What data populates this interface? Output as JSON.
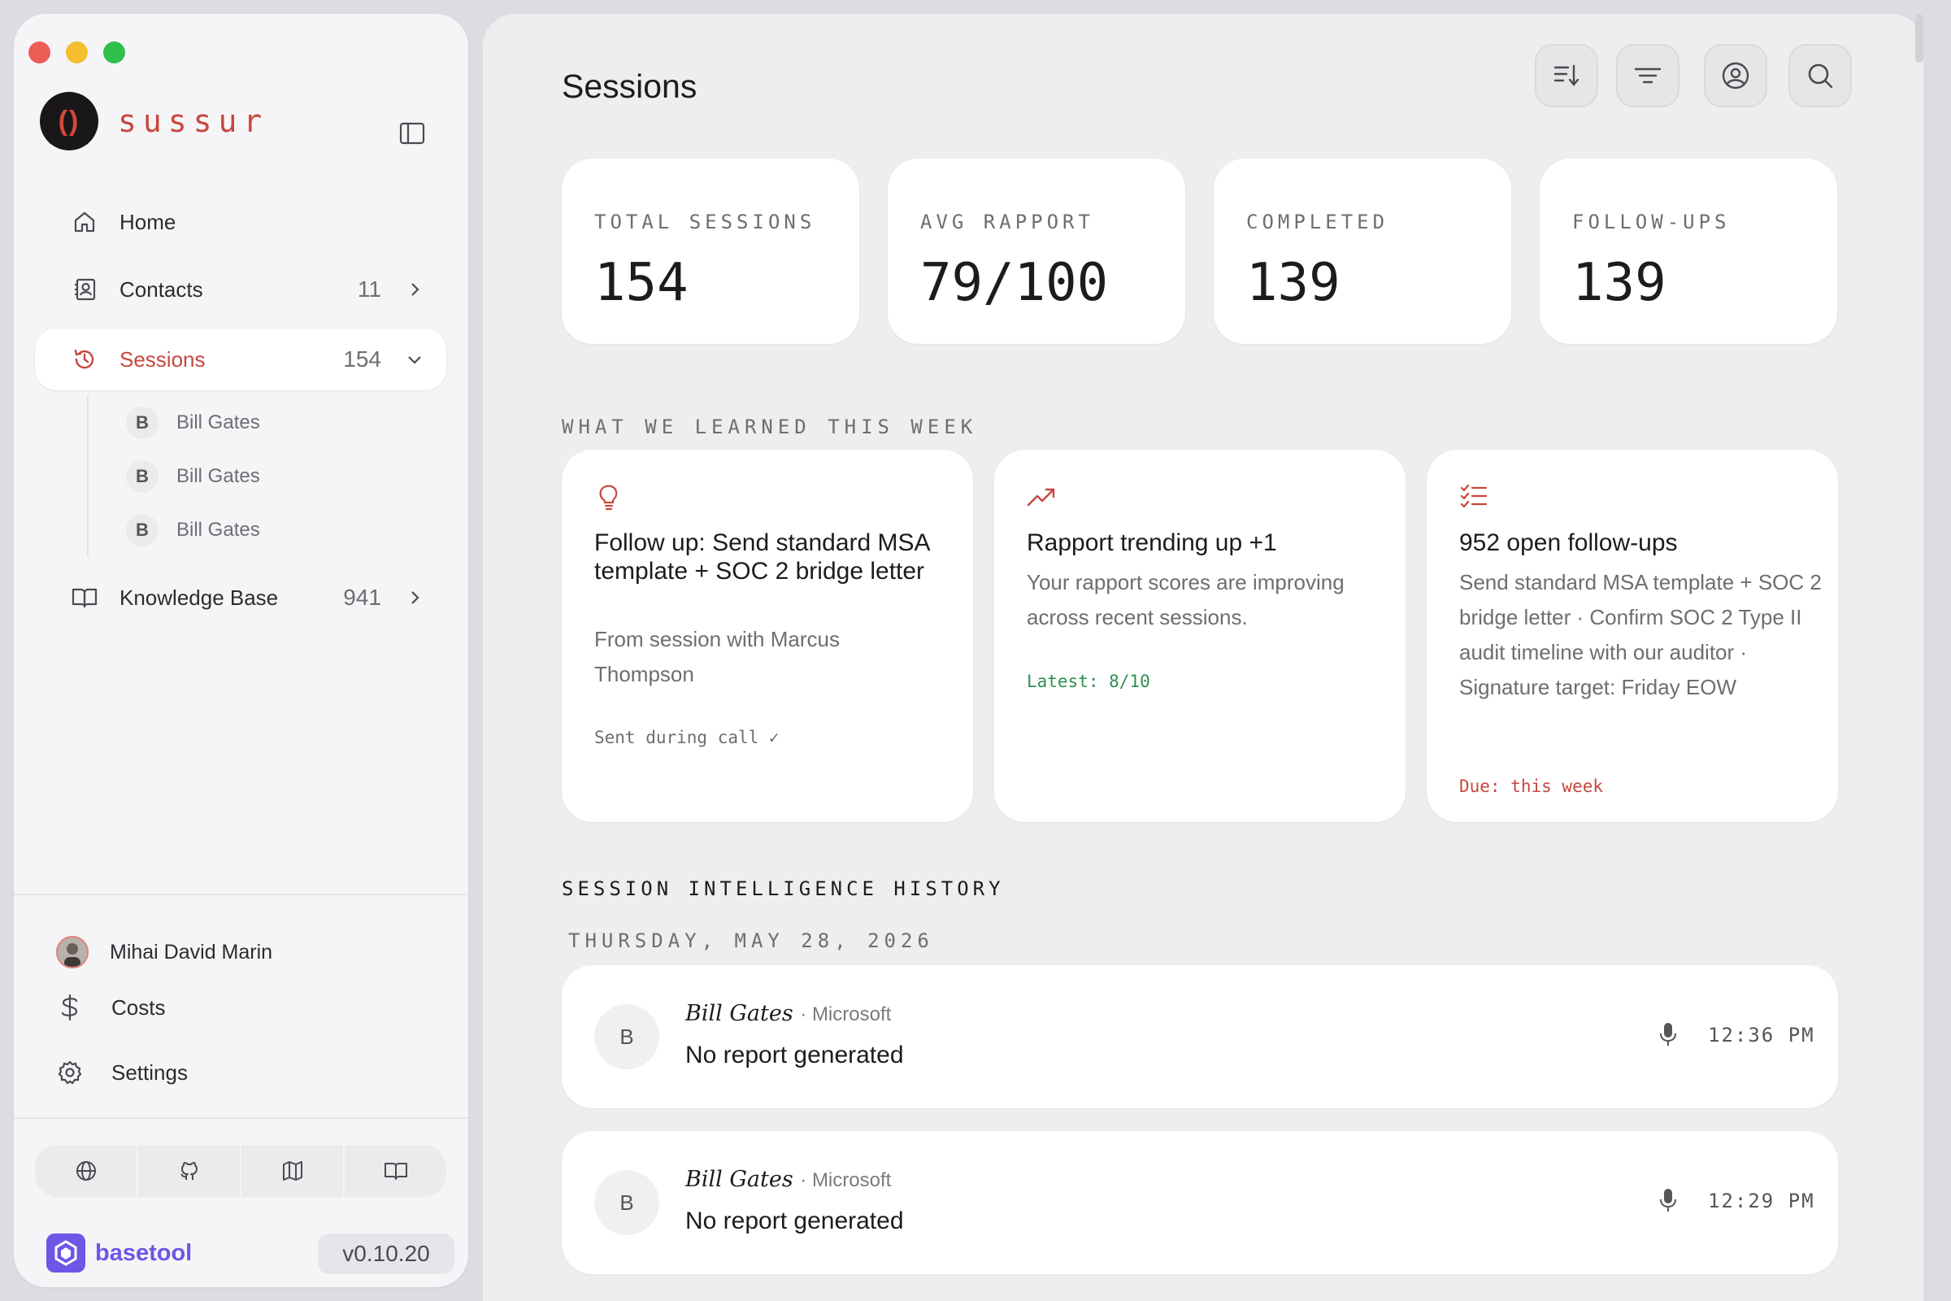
{
  "brand": {
    "name": "sussur",
    "logo_glyph": "()"
  },
  "nav": {
    "home": {
      "label": "Home"
    },
    "contacts": {
      "label": "Contacts",
      "count": "11"
    },
    "sessions": {
      "label": "Sessions",
      "count": "154"
    },
    "knowledge": {
      "label": "Knowledge Base",
      "count": "941"
    },
    "session_children": [
      {
        "initial": "B",
        "label": "Bill Gates"
      },
      {
        "initial": "B",
        "label": "Bill Gates"
      },
      {
        "initial": "B",
        "label": "Bill Gates"
      }
    ]
  },
  "user": {
    "name": "Mihai David Marin"
  },
  "bottom_nav": {
    "costs": "Costs",
    "settings": "Settings"
  },
  "footer": {
    "brand": "basetool",
    "version": "v0.10.20"
  },
  "page": {
    "title": "Sessions"
  },
  "stats": [
    {
      "label": "TOTAL SESSIONS",
      "value": "154"
    },
    {
      "label": "AVG RAPPORT",
      "value": "79/100"
    },
    {
      "label": "COMPLETED",
      "value": "139"
    },
    {
      "label": "FOLLOW-UPS",
      "value": "139"
    }
  ],
  "learned": {
    "heading": "WHAT WE LEARNED THIS WEEK",
    "cards": [
      {
        "icon": "lightbulb-icon",
        "title": "Follow up: Send standard MSA template + SOC 2 bridge letter",
        "text": "From session with Marcus Thompson",
        "meta": "Sent during call ✓"
      },
      {
        "icon": "trending-up-icon",
        "title": "Rapport trending up +1",
        "text": "Your rapport scores are improving across recent sessions.",
        "meta": "Latest: 8/10"
      },
      {
        "icon": "checklist-icon",
        "title": "952 open follow-ups",
        "text": "Send standard MSA template + SOC 2 bridge letter · Confirm SOC 2 Type II audit timeline with our auditor · Signature target: Friday EOW",
        "meta": "Due: this week"
      }
    ]
  },
  "history": {
    "heading": "SESSION INTELLIGENCE HISTORY",
    "date": "THURSDAY, MAY 28, 2026",
    "sessions": [
      {
        "initial": "B",
        "name": "Bill Gates",
        "company": "· Microsoft",
        "report": "No report generated",
        "time": "12:36 PM"
      },
      {
        "initial": "B",
        "name": "Bill Gates",
        "company": "· Microsoft",
        "report": "No report generated",
        "time": "12:29 PM"
      }
    ]
  },
  "colors": {
    "accent": "#c8473e",
    "success": "#2f8f4e",
    "danger": "#c8473e",
    "basetool": "#6e56e6"
  }
}
